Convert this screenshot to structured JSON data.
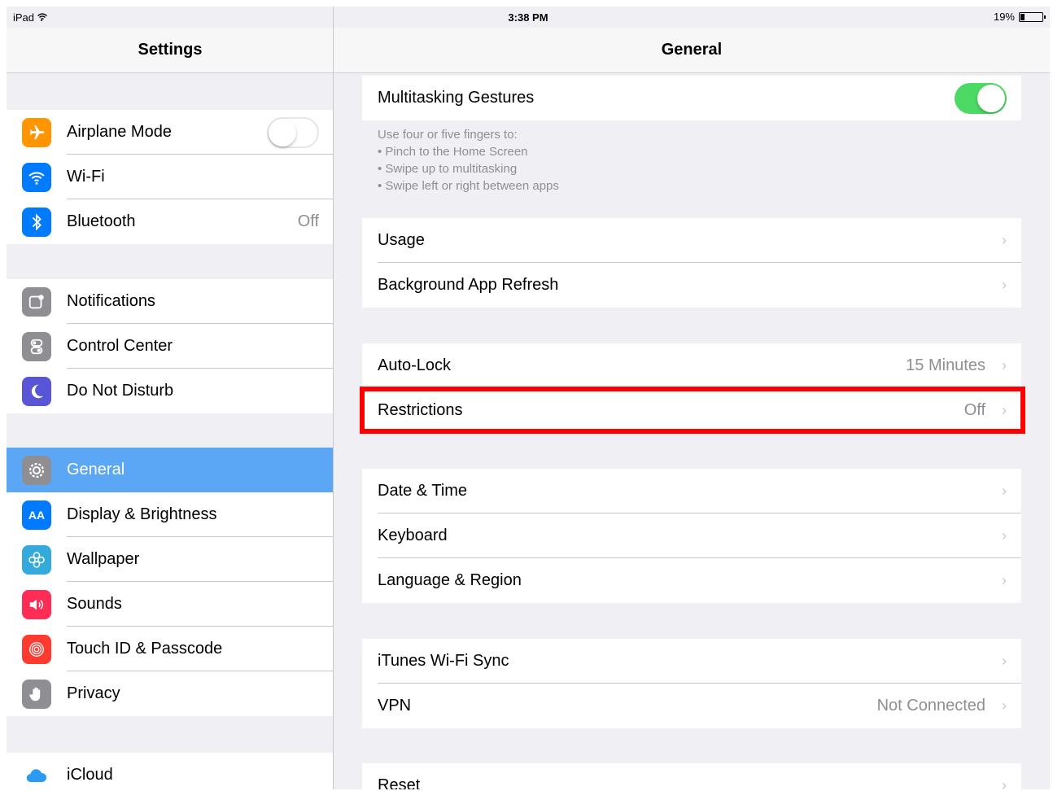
{
  "status_bar": {
    "carrier": "iPad",
    "time": "3:38 PM",
    "battery_text": "19%",
    "battery_level": 0.19
  },
  "master": {
    "title": "Settings",
    "groups": [
      [
        {
          "label": "Airplane Mode",
          "icon": "airplane-icon",
          "color": "#ff9500",
          "toggle": false
        },
        {
          "label": "Wi-Fi",
          "icon": "wifi-icon",
          "color": "#007aff"
        },
        {
          "label": "Bluetooth",
          "icon": "bluetooth-icon",
          "color": "#007aff",
          "value": "Off"
        }
      ],
      [
        {
          "label": "Notifications",
          "icon": "notifications-icon",
          "color": "#8e8e93"
        },
        {
          "label": "Control Center",
          "icon": "control-center-icon",
          "color": "#8e8e93"
        },
        {
          "label": "Do Not Disturb",
          "icon": "moon-icon",
          "color": "#5856d6"
        }
      ],
      [
        {
          "label": "General",
          "icon": "gear-icon",
          "color": "#8e8e93",
          "selected": true
        },
        {
          "label": "Display & Brightness",
          "icon": "display-icon",
          "color": "#007aff"
        },
        {
          "label": "Wallpaper",
          "icon": "wallpaper-icon",
          "color": "#34aadc"
        },
        {
          "label": "Sounds",
          "icon": "speaker-icon",
          "color": "#ff2d55"
        },
        {
          "label": "Touch ID & Passcode",
          "icon": "fingerprint-icon",
          "color": "#ff3b30"
        },
        {
          "label": "Privacy",
          "icon": "hand-icon",
          "color": "#8e8e93"
        }
      ],
      [
        {
          "label": "iCloud",
          "icon": "cloud-icon",
          "color": "#ffffff"
        }
      ]
    ]
  },
  "detail": {
    "title": "General",
    "multitasking": {
      "label": "Multitasking Gestures",
      "toggle": true,
      "footnote": [
        "Use four or five fingers to:",
        "• Pinch to the Home Screen",
        "• Swipe up to multitasking",
        "• Swipe left or right between apps"
      ]
    },
    "groups": [
      [
        {
          "label": "Usage"
        },
        {
          "label": "Background App Refresh"
        }
      ],
      [
        {
          "label": "Auto-Lock",
          "value": "15 Minutes"
        },
        {
          "label": "Restrictions",
          "value": "Off"
        }
      ],
      [
        {
          "label": "Date & Time"
        },
        {
          "label": "Keyboard"
        },
        {
          "label": "Language & Region"
        }
      ],
      [
        {
          "label": "iTunes Wi-Fi Sync"
        },
        {
          "label": "VPN",
          "value": "Not Connected"
        }
      ],
      [
        {
          "label": "Reset"
        }
      ]
    ],
    "chevron": "›"
  },
  "colors": {
    "highlight": "#ff0000",
    "selected": "#5ba6f5",
    "toggle_on": "#4cd964"
  }
}
